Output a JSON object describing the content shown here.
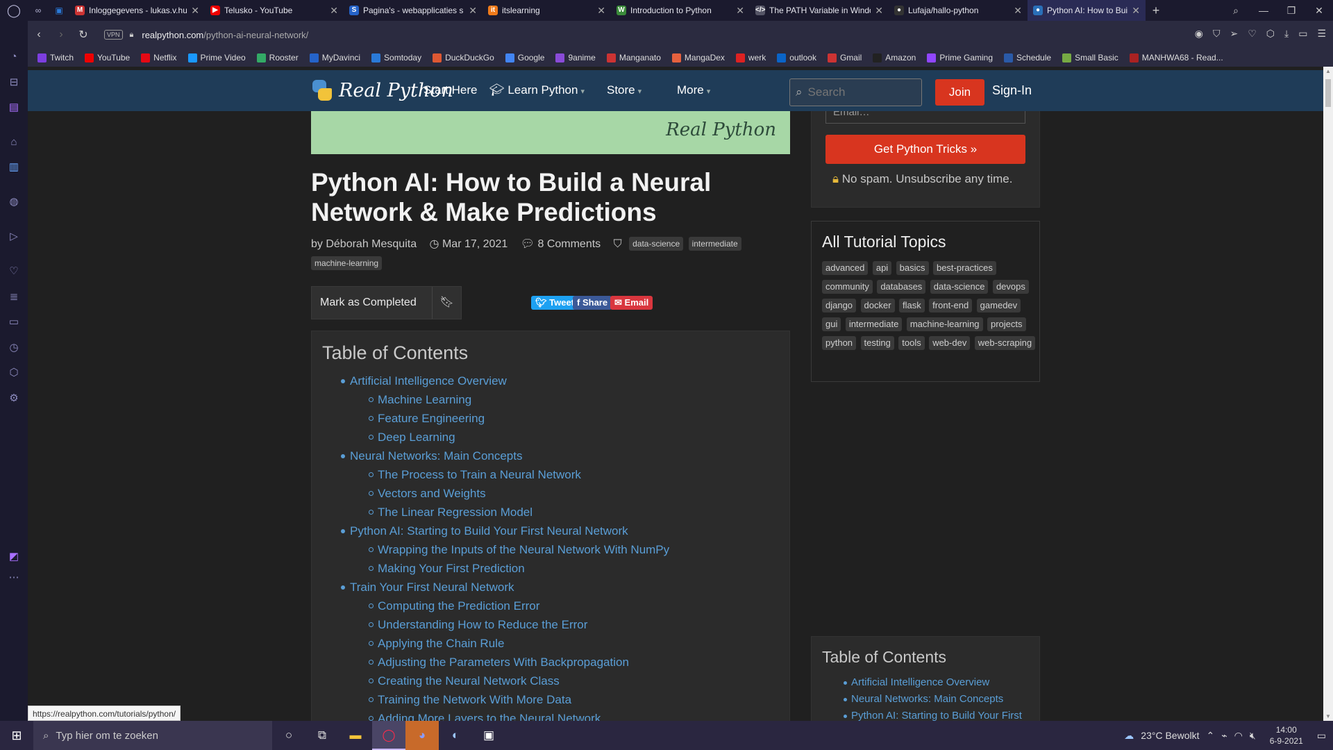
{
  "browser": {
    "tabs": [
      {
        "title": "Inloggegevens - lukas.v.hul",
        "fav": "M",
        "color": "#c33"
      },
      {
        "title": "Telusko - YouTube",
        "fav": "▶",
        "color": "#e00"
      },
      {
        "title": "Pagina's - webapplicaties s",
        "fav": "S",
        "color": "#2563c9"
      },
      {
        "title": "itslearning",
        "fav": "it",
        "color": "#f07a1a"
      },
      {
        "title": "Introduction to Python",
        "fav": "W",
        "color": "#3a8a3a"
      },
      {
        "title": "The PATH Variable in Windo",
        "fav": "</>",
        "color": "#556"
      },
      {
        "title": "Lufaja/hallo-python",
        "fav": "●",
        "color": "#333"
      },
      {
        "title": "Python AI: How to Build a N",
        "fav": "●",
        "color": "#2a6fb8"
      }
    ],
    "url_host": "realpython.com",
    "url_path": "/python-ai-neural-network/",
    "vpn_label": "VPN"
  },
  "bookmarks": [
    {
      "label": "Twitch",
      "color": "#7d3ee0"
    },
    {
      "label": "YouTube",
      "color": "#e00"
    },
    {
      "label": "Netflix",
      "color": "#e50914"
    },
    {
      "label": "Prime Video",
      "color": "#1a98ff"
    },
    {
      "label": "Rooster",
      "color": "#3a6"
    },
    {
      "label": "MyDavinci",
      "color": "#2563c9"
    },
    {
      "label": "Somtoday",
      "color": "#2a7ad8"
    },
    {
      "label": "DuckDuckGo",
      "color": "#de5833"
    },
    {
      "label": "Google",
      "color": "#4285f4"
    },
    {
      "label": "9anime",
      "color": "#8a4bd8"
    },
    {
      "label": "Manganato",
      "color": "#c33"
    },
    {
      "label": "MangaDex",
      "color": "#e6613e"
    },
    {
      "label": "werk",
      "color": "#d22"
    },
    {
      "label": "outlook",
      "color": "#0a64c8"
    },
    {
      "label": "Gmail",
      "color": "#c33"
    },
    {
      "label": "Amazon",
      "color": "#222"
    },
    {
      "label": "Prime Gaming",
      "color": "#9146ff"
    },
    {
      "label": "Schedule",
      "color": "#2a5aa8"
    },
    {
      "label": "Small Basic",
      "color": "#7a4"
    },
    {
      "label": "MANHWA68 - Read...",
      "color": "#a22"
    }
  ],
  "site": {
    "logo_text": "Real Python",
    "nav": [
      "Start Here",
      "Learn Python",
      "Store",
      "More"
    ],
    "search_placeholder": "Search",
    "join_label": "Join",
    "signin_label": "Sign-In",
    "banner_text": "Real Python"
  },
  "article": {
    "title": "Python AI: How to Build a Neural Network & Make Predictions",
    "author": "by Déborah Mesquita",
    "date": "Mar 17, 2021",
    "comments": "8 Comments",
    "tags": [
      "data-science",
      "intermediate",
      "machine-learning"
    ],
    "mark_completed": "Mark as Completed",
    "share": {
      "tweet": "Tweet",
      "share": "Share",
      "email": "Email"
    }
  },
  "toc": {
    "heading": "Table of Contents",
    "items": [
      {
        "text": "Artificial Intelligence Overview",
        "level": 1
      },
      {
        "text": "Machine Learning",
        "level": 2
      },
      {
        "text": "Feature Engineering",
        "level": 2
      },
      {
        "text": "Deep Learning",
        "level": 2
      },
      {
        "text": "Neural Networks: Main Concepts",
        "level": 1
      },
      {
        "text": "The Process to Train a Neural Network",
        "level": 2
      },
      {
        "text": "Vectors and Weights",
        "level": 2
      },
      {
        "text": "The Linear Regression Model",
        "level": 2
      },
      {
        "text": "Python AI: Starting to Build Your First Neural Network",
        "level": 1
      },
      {
        "text": "Wrapping the Inputs of the Neural Network With NumPy",
        "level": 2
      },
      {
        "text": "Making Your First Prediction",
        "level": 2
      },
      {
        "text": "Train Your First Neural Network",
        "level": 1
      },
      {
        "text": "Computing the Prediction Error",
        "level": 2
      },
      {
        "text": "Understanding How to Reduce the Error",
        "level": 2
      },
      {
        "text": "Applying the Chain Rule",
        "level": 2
      },
      {
        "text": "Adjusting the Parameters With Backpropagation",
        "level": 2
      },
      {
        "text": "Creating the Neural Network Class",
        "level": 2
      },
      {
        "text": "Training the Network With More Data",
        "level": 2
      },
      {
        "text": "Adding More Layers to the Neural Network",
        "level": 2
      }
    ]
  },
  "sidebar_right": {
    "email_placeholder": "Email…",
    "tricks_button": "Get Python Tricks »",
    "nospam": "No spam. Unsubscribe any time.",
    "topics_heading": "All Tutorial Topics",
    "topics": [
      "advanced",
      "api",
      "basics",
      "best-practices",
      "community",
      "databases",
      "data-science",
      "devops",
      "django",
      "docker",
      "flask",
      "front-end",
      "gamedev",
      "gui",
      "intermediate",
      "machine-learning",
      "projects",
      "python",
      "testing",
      "tools",
      "web-dev",
      "web-scraping"
    ],
    "toc_heading": "Table of Contents",
    "toc_items": [
      "Artificial Intelligence Overview",
      "Neural Networks: Main Concepts",
      "Python AI: Starting to Build Your First"
    ]
  },
  "status_url": "https://realpython.com/tutorials/python/",
  "taskbar": {
    "search_placeholder": "Typ hier om te zoeken",
    "weather": "23°C  Bewolkt",
    "time": "14:00",
    "date": "6-9-2021"
  }
}
